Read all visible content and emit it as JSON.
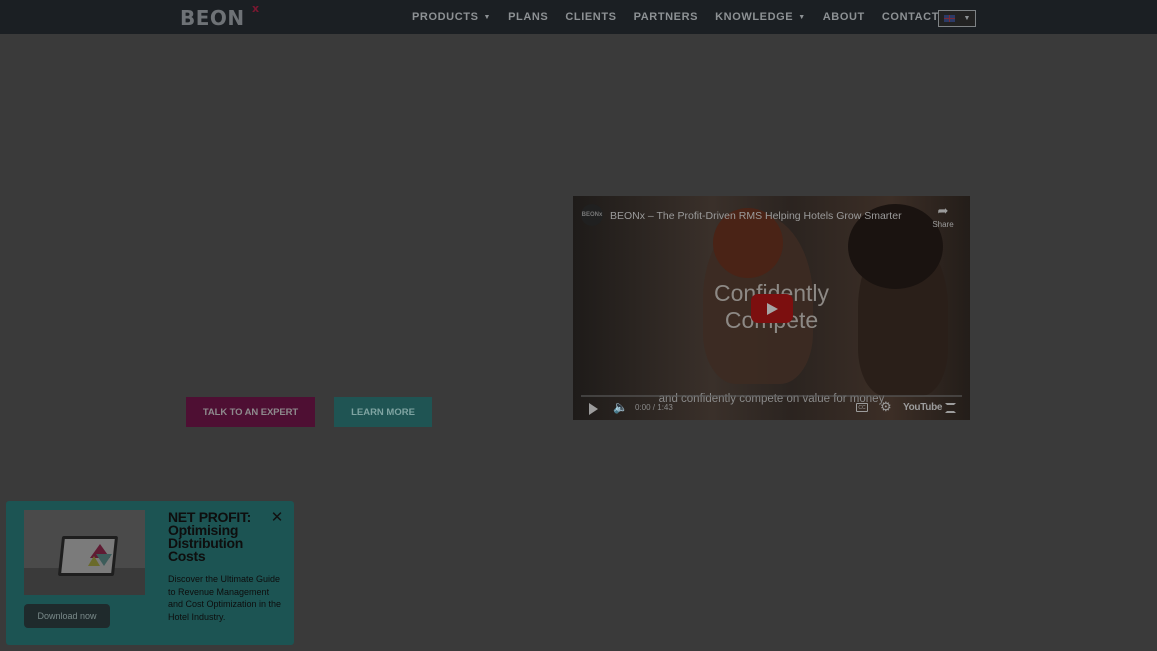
{
  "header": {
    "logo": "BEON",
    "logo_superscript": "x",
    "nav": [
      {
        "label": "PRODUCTS",
        "has_caret": true
      },
      {
        "label": "PLANS",
        "has_caret": false
      },
      {
        "label": "CLIENTS",
        "has_caret": false
      },
      {
        "label": "PARTNERS",
        "has_caret": false
      },
      {
        "label": "KNOWLEDGE",
        "has_caret": true
      },
      {
        "label": "ABOUT",
        "has_caret": false
      },
      {
        "label": "CONTACT",
        "has_caret": false
      }
    ],
    "user_icon": "user-icon",
    "language_flag": "uk-flag-icon"
  },
  "hero": {
    "primary_button": "TALK TO AN EXPERT",
    "secondary_button": "LEARN MORE"
  },
  "video": {
    "channel": "BEONx",
    "title": "BEONx – The Profit-Driven RMS Helping Hotels Grow Smarter",
    "share_label": "Share",
    "overlay_line1": "Confidently",
    "overlay_line2": "Compete",
    "caption": "and confidently compete on value for money",
    "time": "0:00 / 1:43",
    "brand": "YouTube",
    "cc": "CC"
  },
  "popup": {
    "title": "NET PROFIT: Optimising Distribution Costs",
    "description": "Discover the Ultimate Guide to Revenue Management and Cost Optimization in the Hotel Industry.",
    "button": "Download now",
    "close_glyph": "✕"
  },
  "colors": {
    "header_bg": "#1b1f23",
    "overlay_bg": "#3a3a3a",
    "accent_magenta": "#4e0f33",
    "accent_teal": "#1f5453"
  }
}
